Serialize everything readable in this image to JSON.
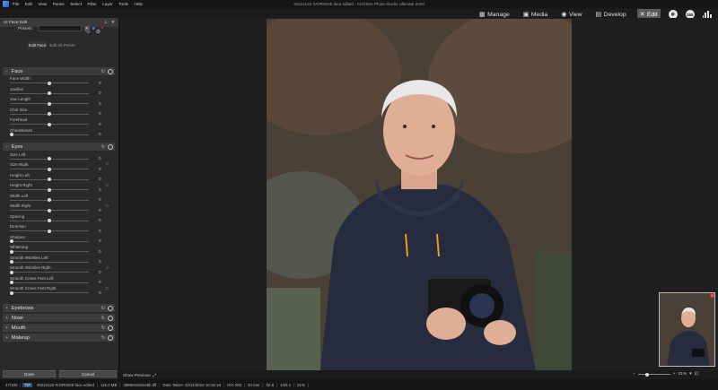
{
  "menubar": {
    "items": [
      "File",
      "Edit",
      "View",
      "Panes",
      "Select",
      "Filter",
      "Layer",
      "Tools",
      "Help"
    ],
    "document_title": "20221122-IVOR0025 face edited - ACDSee Photo Studio Ultimate 2023"
  },
  "modes": {
    "manage": "Manage",
    "media": "Media",
    "view": "View",
    "develop": "Develop",
    "edit": "Edit",
    "badge_365": "365"
  },
  "panel": {
    "title": "AI Face Edit",
    "presets_label": "Presets",
    "tabs": [
      "Edit Face",
      "Edit All Points"
    ],
    "sections": {
      "face": {
        "title": "Face",
        "sliders": [
          {
            "label": "Face Width",
            "value": "0"
          },
          {
            "label": "Jawline",
            "value": "0"
          },
          {
            "label": "Jaw Length",
            "value": "0"
          },
          {
            "label": "Chin Size",
            "value": "0"
          },
          {
            "label": "Forehead",
            "value": "0"
          },
          {
            "label": "Cheekbones",
            "value": "0"
          }
        ]
      },
      "eyes": {
        "title": "Eyes",
        "sliders": [
          {
            "label": "Size Left",
            "value": "0"
          },
          {
            "label": "Size Right",
            "value": "0"
          },
          {
            "label": "Height Left",
            "value": "0"
          },
          {
            "label": "Height Right",
            "value": "0"
          },
          {
            "label": "Width Left",
            "value": "0"
          },
          {
            "label": "Width Right",
            "value": "0"
          },
          {
            "label": "Spacing",
            "value": "0"
          },
          {
            "label": "Direction",
            "value": "0"
          },
          {
            "label": "Sharpen",
            "value": "0"
          },
          {
            "label": "Whitening",
            "value": "0"
          },
          {
            "label": "Smooth Wrinkles Left",
            "value": "0"
          },
          {
            "label": "Smooth Wrinkles Right",
            "value": "0"
          },
          {
            "label": "Smooth Crows Feet Left",
            "value": "0"
          },
          {
            "label": "Smooth Crows Feet Right",
            "value": "0"
          }
        ]
      },
      "eyebrows": {
        "title": "Eyebrows"
      },
      "nose": {
        "title": "Nose"
      },
      "mouth": {
        "title": "Mouth"
      },
      "makeup": {
        "title": "Makeup"
      }
    },
    "done_label": "Done",
    "cancel_label": "Cancel"
  },
  "viewer": {
    "show_previous": "Show Previous",
    "zoom": "21%"
  },
  "status": {
    "position": "47/100",
    "type": "TIF",
    "filename": "20221122-IVOR0025 face edited",
    "size": "115.3 MB",
    "dimensions": "3986x5184x48b tiff",
    "date_taken": "Date Taken: 22/11/2022 10:16:18",
    "iso": "ISO 200",
    "focal": "34 mm",
    "aperture": "f/2.8",
    "shutter": "1/25 s",
    "zoom": "21%"
  },
  "colors": {
    "accent": "#4a90e2",
    "panel_bg": "#2a2a2a",
    "section_bg": "#3c3c3c"
  }
}
